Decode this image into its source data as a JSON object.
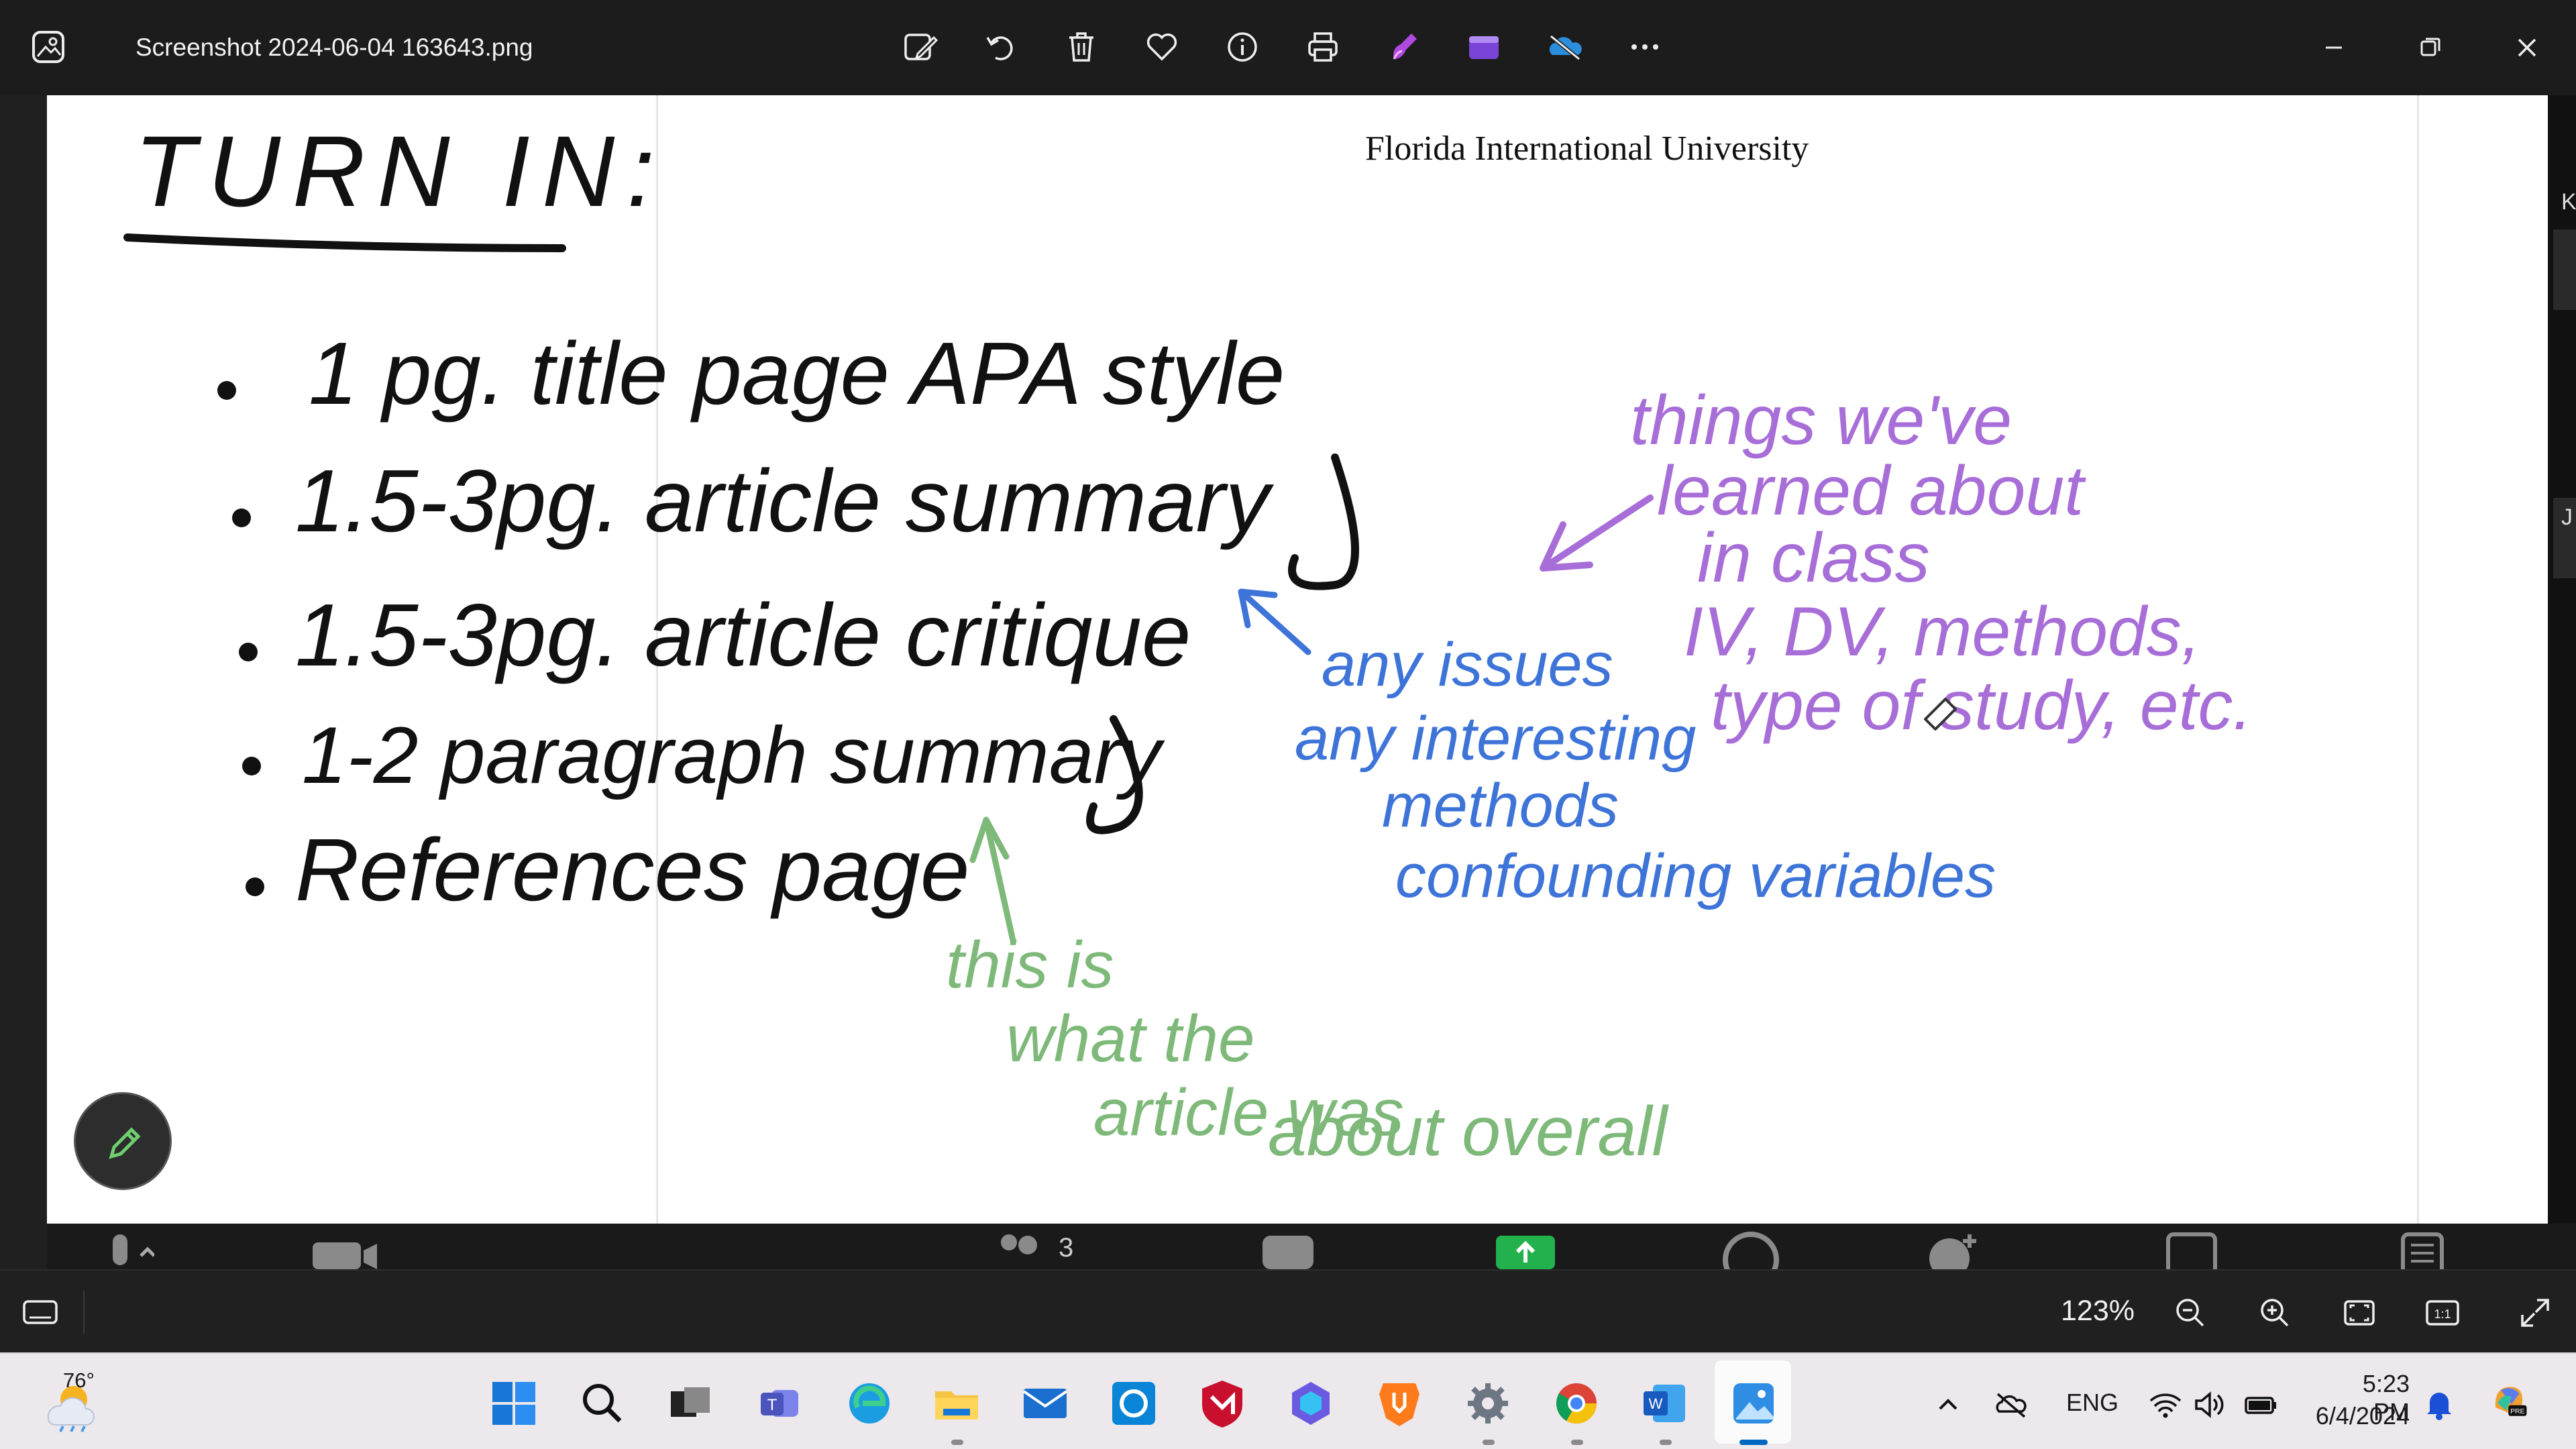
{
  "window": {
    "file_name": "Screenshot 2024-06-04 163643.png",
    "toolbar": [
      "edit-image",
      "rotate",
      "delete",
      "favorite",
      "file-info",
      "print",
      "designer",
      "clipchamp",
      "onedrive",
      "more"
    ]
  },
  "document": {
    "header": "Florida International University",
    "whiteboard": {
      "heading": "TURN IN:",
      "items": [
        "1 pg. title page APA style",
        "1.5-3pg. article summary",
        "1.5-3pg. article critique",
        "1-2 paragraph summary",
        "References page"
      ],
      "annotations": {
        "purple": "things we've learned about in class IV, DV, methods, type of study, etc.",
        "blue": "any issues any interesting methods confounding variables",
        "green": "this is what the article was about overall"
      }
    },
    "right_panel_letters": [
      "K",
      "J"
    ]
  },
  "meeting_toolbar": {
    "participants": "3"
  },
  "photos_bar": {
    "zoom": "123%",
    "buttons": [
      "zoom-out",
      "zoom-in",
      "fit-to-window",
      "actual-size",
      "fullscreen"
    ]
  },
  "taskbar": {
    "weather_temp": "76°",
    "apps": [
      "windows",
      "search",
      "task-view",
      "teams",
      "edge",
      "file-explorer",
      "mail",
      "cortana",
      "mcafee",
      "copilot",
      "brave",
      "settings",
      "chrome",
      "word",
      "photos"
    ],
    "language": "ENG",
    "time": "5:23 PM",
    "date": "6/4/2024",
    "colors": {
      "accent": "#0067c0",
      "taskbar": "#ece8ec"
    }
  }
}
